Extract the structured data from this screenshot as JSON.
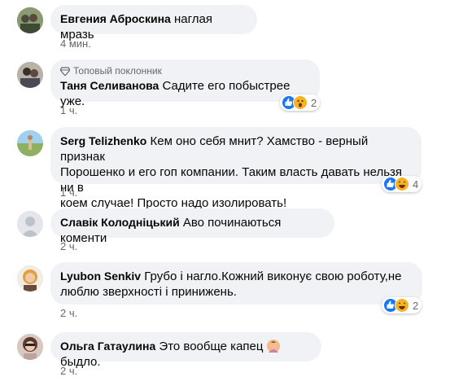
{
  "comments": [
    {
      "author": "Евгения Аброскина",
      "text": "наглая мразь",
      "time": "4 мин."
    },
    {
      "badge": "Топовый поклонник",
      "author": "Таня Селиванова",
      "text": "Садите его побыстрее уже.",
      "time": "1 ч.",
      "reactions": {
        "types": [
          "like-icon",
          "wow-icon"
        ],
        "count": "2"
      }
    },
    {
      "author": "Serg Telizhenko",
      "text_lines": [
        "Кем оно себя мнит? Хамство - верный признак",
        "Порошенко и его гоп компании. Таким власть давать нельзя ни в",
        "коем случае! Просто надо изолировать!"
      ],
      "time": "1 ч.",
      "reactions": {
        "types": [
          "like-icon",
          "haha-icon"
        ],
        "count": "4"
      }
    },
    {
      "author": "Славік Колодніцький",
      "text": "Аво починаються коменти",
      "time": "2 ч."
    },
    {
      "author": "Lyubon Senkiv",
      "text_lines": [
        "Грубо і нагло.Кожний виконує свою роботу,не",
        "люблю зверхності і принижень."
      ],
      "time": "2 ч.",
      "reactions": {
        "types": [
          "like-icon",
          "haha-icon"
        ],
        "count": "2"
      }
    },
    {
      "author": "Ольга Гатаулина",
      "text_before": "Это вообще капец",
      "text_after": "быдло.",
      "time": "2 ч."
    }
  ],
  "colors": {
    "bubble": "#f0f2f5",
    "meta": "#65676b",
    "like": "#1877f2",
    "emoji": "#f7b125"
  }
}
